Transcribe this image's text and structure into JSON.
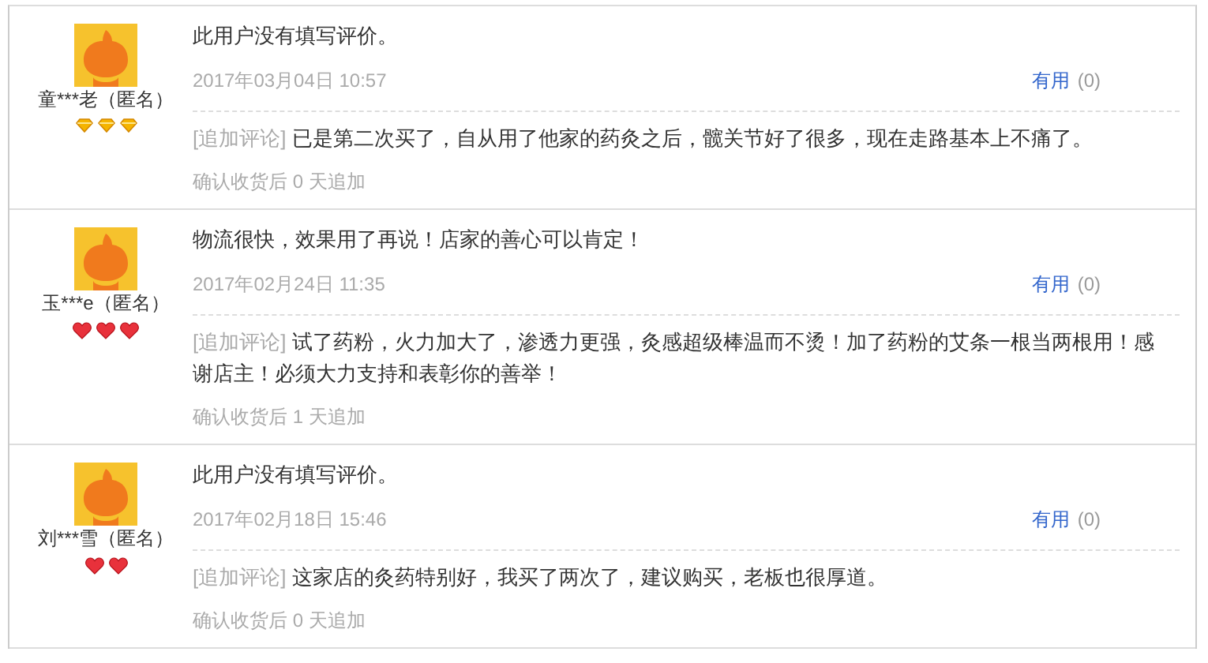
{
  "reviews": [
    {
      "user": "童***老（匿名）",
      "badges": [
        {
          "kind": "diamond"
        },
        {
          "kind": "diamond"
        },
        {
          "kind": "diamond"
        }
      ],
      "comment": "此用户没有填写评价。",
      "date": "2017年03月04日 10:57",
      "useful": {
        "label": "有用",
        "count": "(0)"
      },
      "followup": {
        "label": "[追加评论]",
        "text": "已是第二次买了，自从用了他家的药灸之后，髋关节好了很多，现在走路基本上不痛了。",
        "note": "确认收货后 0 天追加"
      }
    },
    {
      "user": "玉***e（匿名）",
      "badges": [
        {
          "kind": "heart"
        },
        {
          "kind": "heart"
        },
        {
          "kind": "heart"
        }
      ],
      "comment": "物流很快，效果用了再说！店家的善心可以肯定！",
      "date": "2017年02月24日 11:35",
      "useful": {
        "label": "有用",
        "count": "(0)"
      },
      "followup": {
        "label": "[追加评论]",
        "text": "试了药粉，火力加大了，渗透力更强，灸感超级棒温而不烫！加了药粉的艾条一根当两根用！感谢店主！必须大力支持和表彰你的善举！",
        "note": "确认收货后 1 天追加"
      }
    },
    {
      "user": "刘***雪（匿名）",
      "badges": [
        {
          "kind": "heart"
        },
        {
          "kind": "heart"
        }
      ],
      "comment": "此用户没有填写评价。",
      "date": "2017年02月18日 15:46",
      "useful": {
        "label": "有用",
        "count": "(0)"
      },
      "followup": {
        "label": "[追加评论]",
        "text": "这家店的灸药特别好，我买了两次了，建议购买，老板也很厚道。",
        "note": "确认收货后 0 天追加"
      }
    }
  ]
}
